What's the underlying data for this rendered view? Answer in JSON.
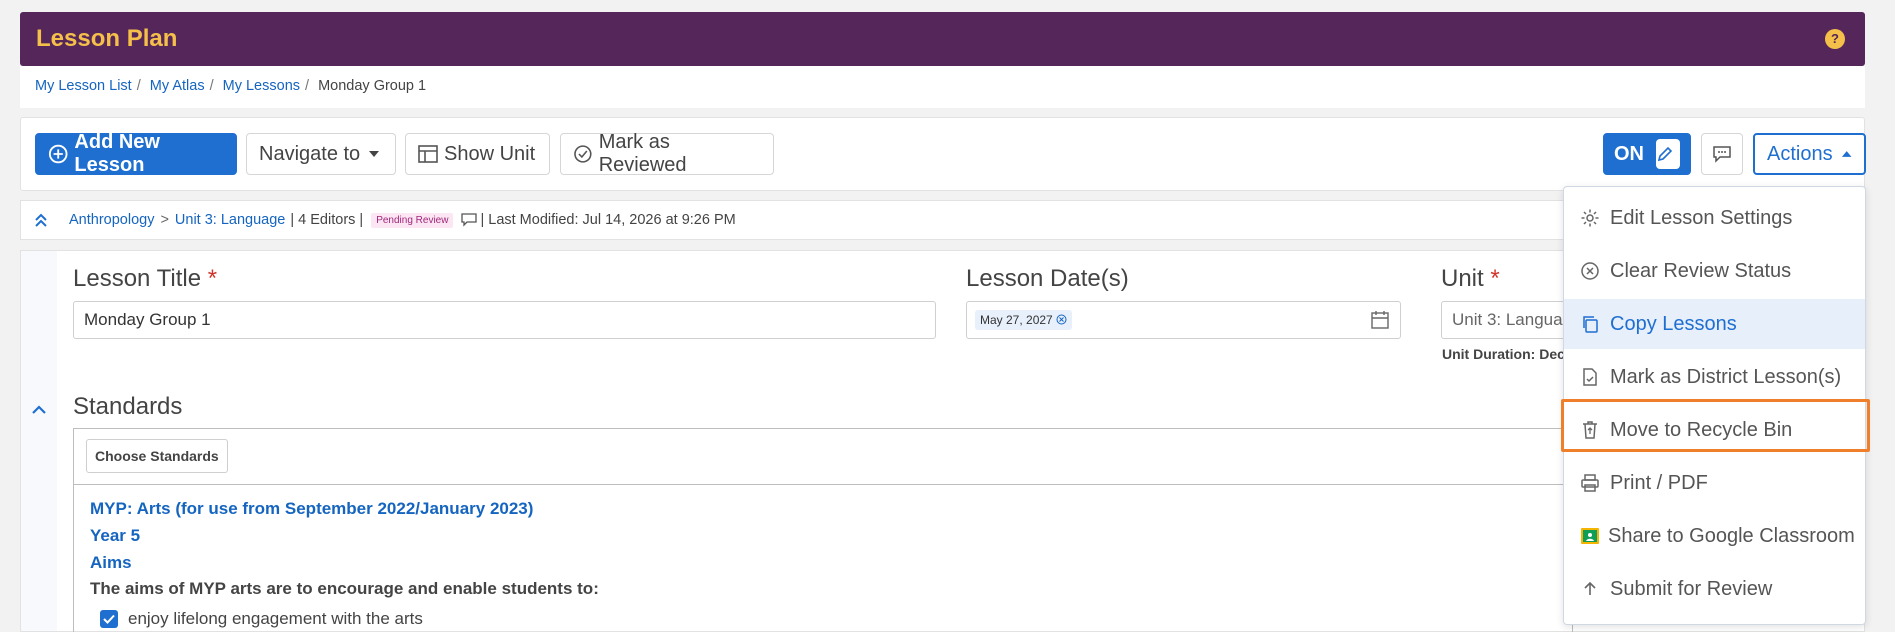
{
  "header": {
    "title": "Lesson Plan"
  },
  "breadcrumb": {
    "items": [
      "My Lesson List",
      "My Atlas",
      "My Lessons"
    ],
    "current": "Monday Group 1"
  },
  "toolbar": {
    "add_lesson": "Add New Lesson",
    "navigate": "Navigate to",
    "show_unit": "Show Unit",
    "mark_reviewed": "Mark as Reviewed",
    "edit_toggle": "ON",
    "actions": "Actions"
  },
  "info": {
    "subject": "Anthropology",
    "unit": "Unit 3: Language",
    "editors": "| 4 Editors |",
    "status": "Pending Review",
    "last_modified": "| Last Modified: Jul 14, 2026 at 9:26 PM"
  },
  "form": {
    "lesson_title_label": "Lesson Title",
    "lesson_title_value": "Monday Group 1",
    "lesson_dates_label": "Lesson Date(s)",
    "lesson_date_chip": "May 27, 2027",
    "unit_label": "Unit",
    "unit_value": "Unit 3: Langua",
    "unit_duration": "Unit Duration: Dec",
    "required_mark": "*"
  },
  "standards": {
    "heading": "Standards",
    "choose_button": "Choose Standards",
    "framework": "MYP: Arts (for use from September 2022/January 2023)",
    "year": "Year 5",
    "aims": "Aims",
    "aims_intro": "The aims of MYP arts are to encourage and enable students to:",
    "items": [
      "enjoy lifelong engagement with the arts"
    ]
  },
  "actions_menu": {
    "items": [
      "Edit Lesson Settings",
      "Clear Review Status",
      "Copy Lessons",
      "Mark as District Lesson(s)",
      "Move to Recycle Bin",
      "Print / PDF",
      "Share to Google Classroom",
      "Submit for Review"
    ],
    "active_item": "Copy Lessons",
    "highlighted_item": "Move to Recycle Bin"
  },
  "colors": {
    "banner": "#55265a",
    "banner_title": "#f5c04a",
    "primary": "#1f6fd1",
    "highlight": "#f07f2b"
  }
}
